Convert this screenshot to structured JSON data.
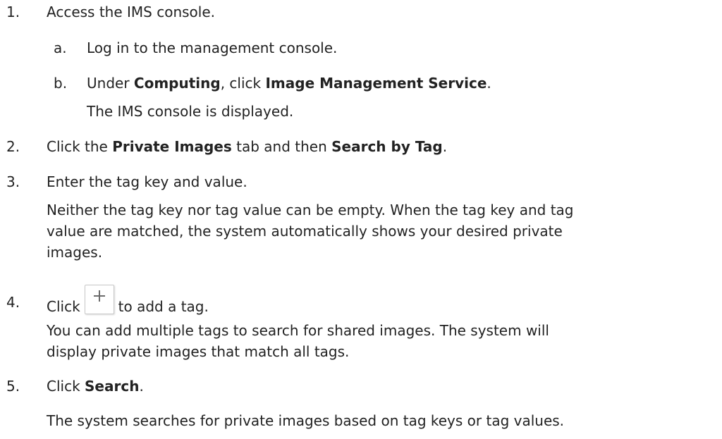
{
  "steps": [
    {
      "num": "1.",
      "text": "Access the IMS console.",
      "substeps": [
        {
          "letter": "a.",
          "text": "Log in to the management console."
        },
        {
          "letter": "b.",
          "pre": "Under ",
          "bold1": "Computing",
          "mid": ", click ",
          "bold2": "Image Management Service",
          "post": ".",
          "result": "The IMS console is displayed."
        }
      ]
    },
    {
      "num": "2.",
      "pre": "Click the ",
      "bold1": "Private Images",
      "mid": " tab and then ",
      "bold2": "Search by Tag",
      "post": "."
    },
    {
      "num": "3.",
      "text": "Enter the tag key and value.",
      "note_line1": "Neither the tag key nor tag value can be empty. When the tag key and tag",
      "note_line2": "value are matched, the system automatically shows your desired private",
      "note_line3": "images."
    },
    {
      "num": "4.",
      "pre": "Click",
      "icon": "plus-icon",
      "post": "to add a tag.",
      "note_line1": "You can add multiple tags to search for shared images. The system will",
      "note_line2": "display private images that match all tags."
    },
    {
      "num": "5.",
      "pre": "Click ",
      "bold": "Search",
      "post": ".",
      "note": "The system searches for private images based on tag keys or tag values."
    }
  ]
}
